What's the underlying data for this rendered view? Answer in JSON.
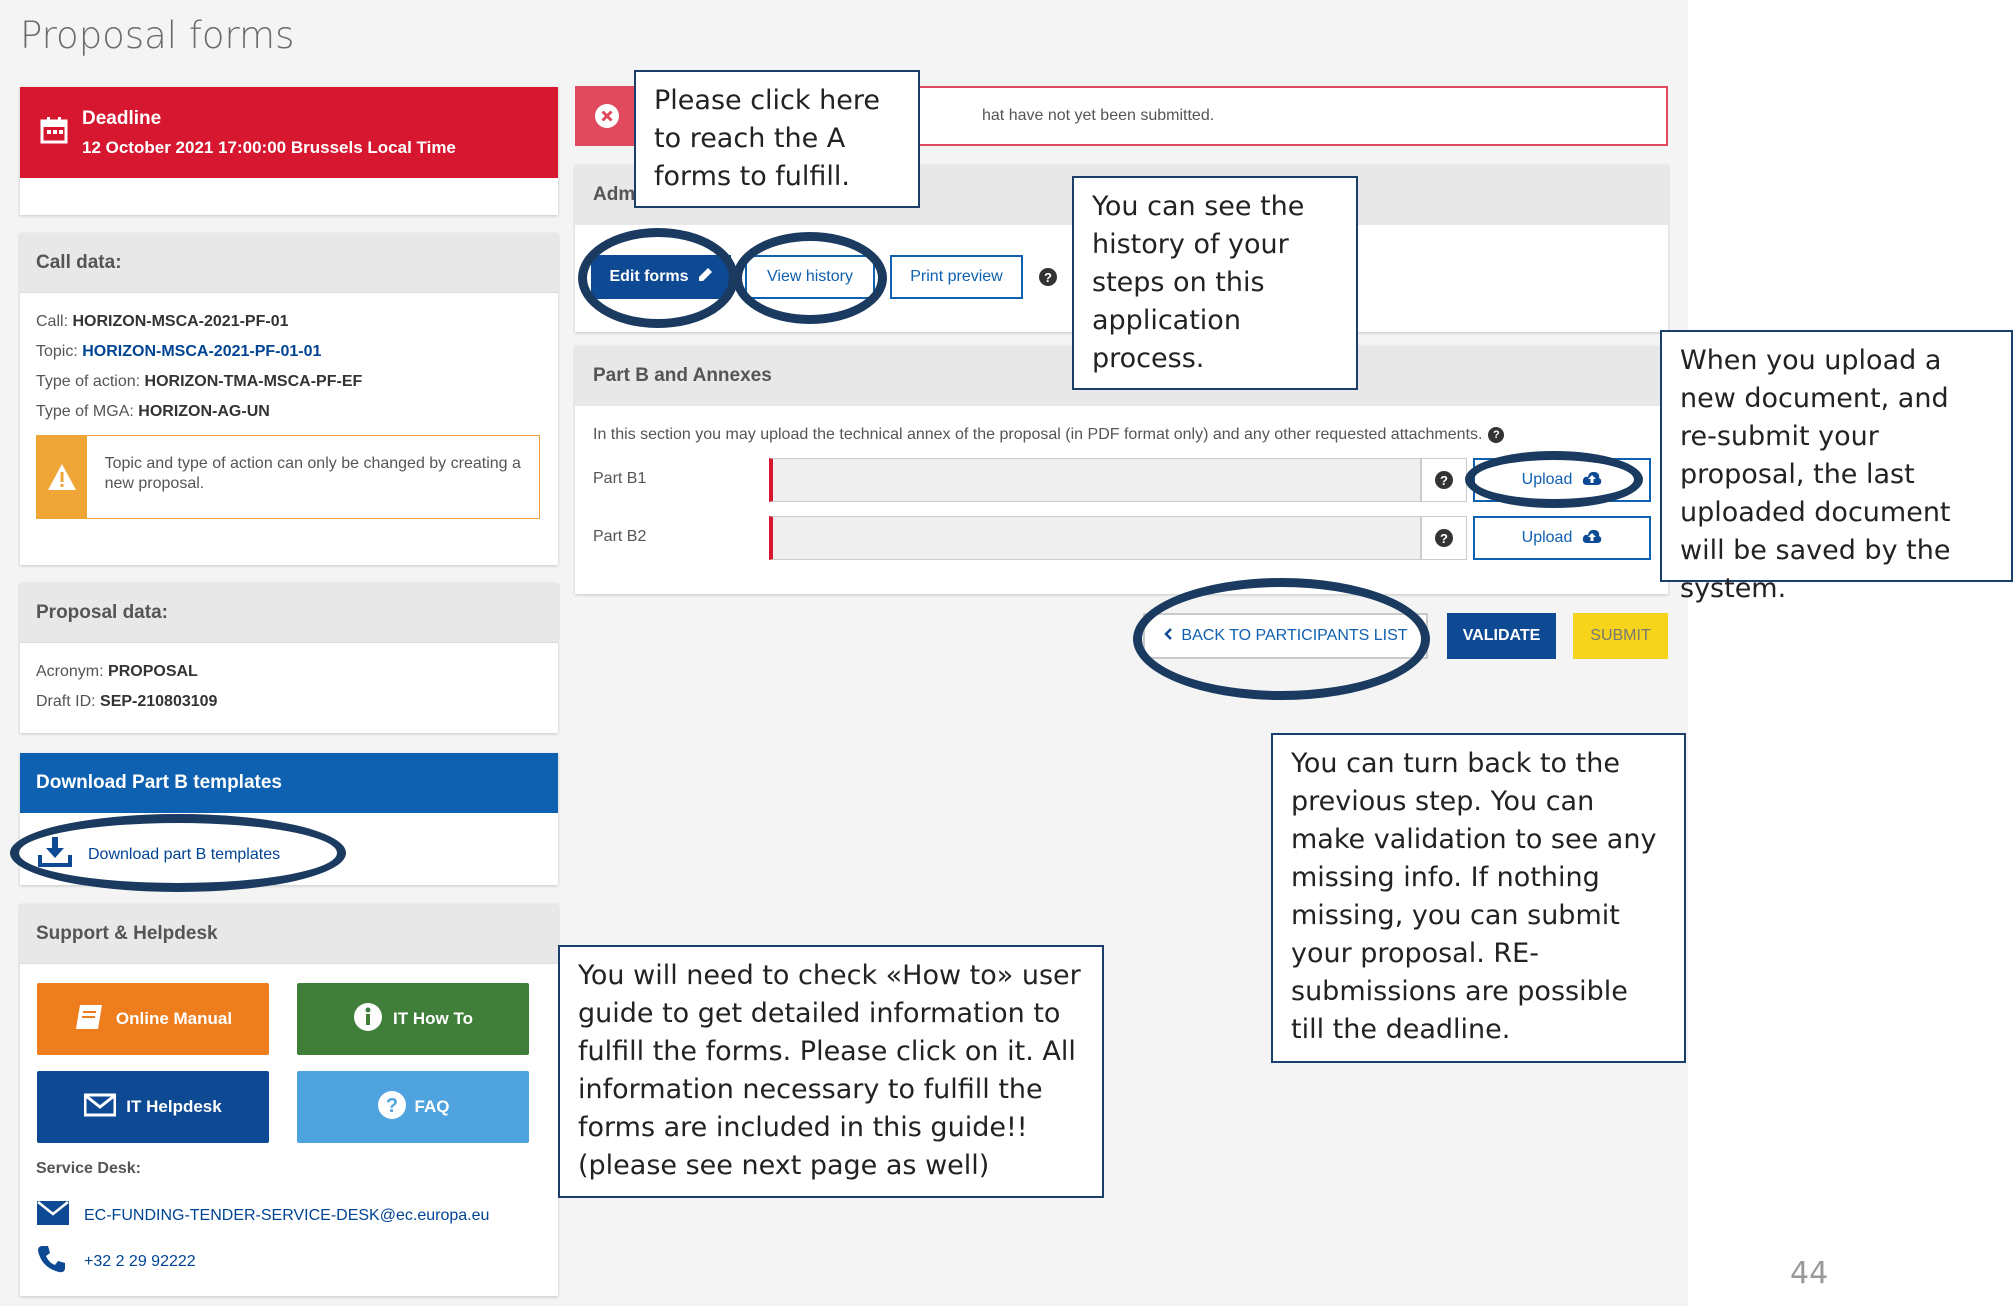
{
  "page": {
    "title": "Proposal forms",
    "page_number": "44"
  },
  "deadline": {
    "label": "Deadline",
    "value": "12 October 2021 17:00:00 Brussels Local Time",
    "color": "#d7172f"
  },
  "call_data": {
    "title": "Call data:",
    "call_label": "Call:",
    "call_value": "HORIZON-MSCA-2021-PF-01",
    "topic_label": "Topic:",
    "topic_value": "HORIZON-MSCA-2021-PF-01-01",
    "action_label": "Type of action:",
    "action_value": "HORIZON-TMA-MSCA-PF-EF",
    "mga_label": "Type of MGA:",
    "mga_value": "HORIZON-AG-UN",
    "warning": "Topic and type of action can only be changed by creating a new proposal."
  },
  "proposal_data": {
    "title": "Proposal data:",
    "acronym_label": "Acronym:",
    "acronym_value": "PROPOSAL",
    "draft_label": "Draft ID:",
    "draft_value": "SEP-210803109"
  },
  "download": {
    "title": "Download Part B templates",
    "link": "Download part B templates"
  },
  "support": {
    "title": "Support & Helpdesk",
    "online_manual": "Online Manual",
    "it_how_to": "IT How To",
    "it_helpdesk": "IT Helpdesk",
    "faq": "FAQ",
    "service_desk_label": "Service Desk:",
    "email": "EC-FUNDING-TENDER-SERVICE-DESK@ec.europa.eu",
    "phone": "+32 2 29 92222"
  },
  "alert": {
    "text": "hat have not yet been submitted."
  },
  "admin": {
    "title_partial": "Adm",
    "edit_forms": "Edit forms",
    "view_history": "View history",
    "print_preview": "Print preview"
  },
  "part_b": {
    "title": "Part B and Annexes",
    "description": "In this section you may upload the technical annex of the proposal (in PDF format only) and any other requested attachments.",
    "rows": [
      {
        "label": "Part B1",
        "button": "Upload"
      },
      {
        "label": "Part B2",
        "button": "Upload"
      }
    ]
  },
  "actions": {
    "back": "BACK TO PARTICIPANTS LIST",
    "validate": "VALIDATE",
    "submit": "SUBMIT"
  },
  "callouts": {
    "edit": "Please click here to reach the A forms to fulfill.",
    "history": "You can see the history of your steps on this application process.",
    "upload": "When you upload a new document, and re-submit your proposal, the last uploaded document will be saved by the system.",
    "back": "You can turn back to the previous step. You can make validation to see any missing info. If nothing missing, you can submit your proposal. RE-submissions are possible till the deadline.",
    "howto": "You will need to check «How to» user guide to get detailed information to fulfill the forms. Please click on it. All information necessary to fulfill the forms are included in this guide!! (please see next page as well)"
  }
}
